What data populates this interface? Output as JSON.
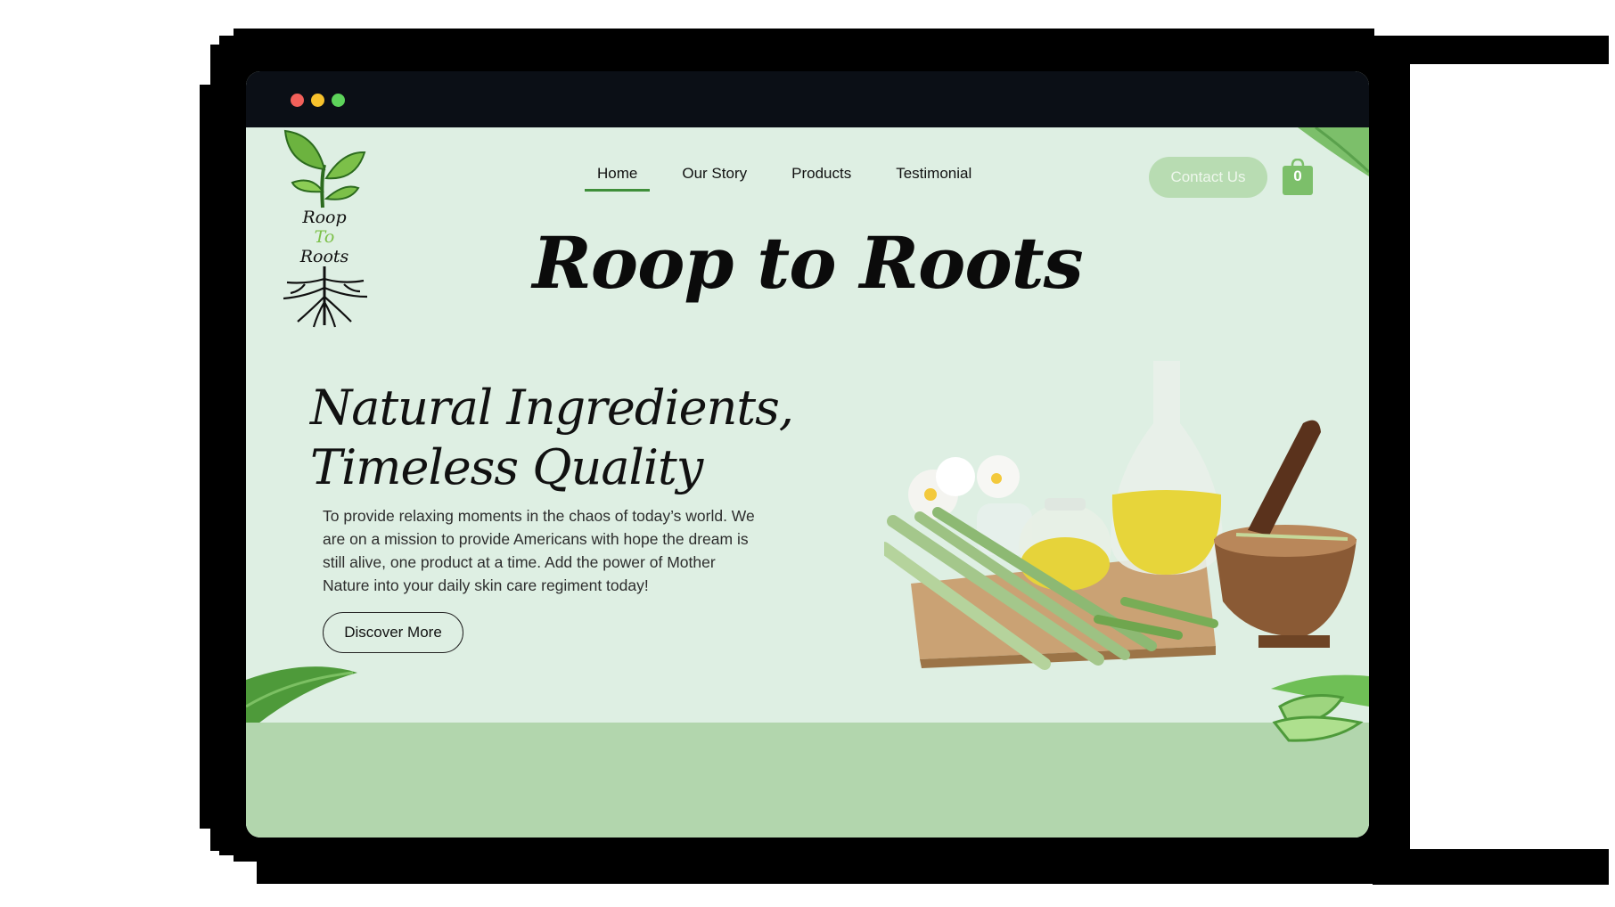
{
  "window": {
    "controls": [
      "close-dot",
      "minimize-dot",
      "maximize-dot"
    ],
    "control_colors": [
      "#f2605a",
      "#f7c12c",
      "#5dd35a"
    ]
  },
  "logo": {
    "line1": "Roop",
    "line2": "To",
    "line3": "Roots"
  },
  "nav": {
    "items": [
      {
        "label": "Home",
        "active": true
      },
      {
        "label": "Our Story",
        "active": false
      },
      {
        "label": "Products",
        "active": false
      },
      {
        "label": "Testimonial",
        "active": false
      }
    ]
  },
  "header": {
    "contact_label": "Contact Us",
    "cart_count": "0"
  },
  "hero": {
    "brand_title": "Roop to Roots",
    "tagline_line1": "Natural Ingredients,",
    "tagline_line2": "Timeless Quality",
    "description": "To provide relaxing moments in the chaos of today’s world. We are on a mission to provide Americans with hope the dream is still alive, one product at a time. Add the power of Mother Nature into your daily skin care regiment today!",
    "cta_label": "Discover More",
    "image": "lemongrass-oil-mortar-image"
  },
  "colors": {
    "background": "#deefe3",
    "accent_green": "#3f8f3a",
    "footer_band": "#b2d6ad",
    "contact_button": "#b8dcb2",
    "cart_green": "#7cbf6a"
  }
}
